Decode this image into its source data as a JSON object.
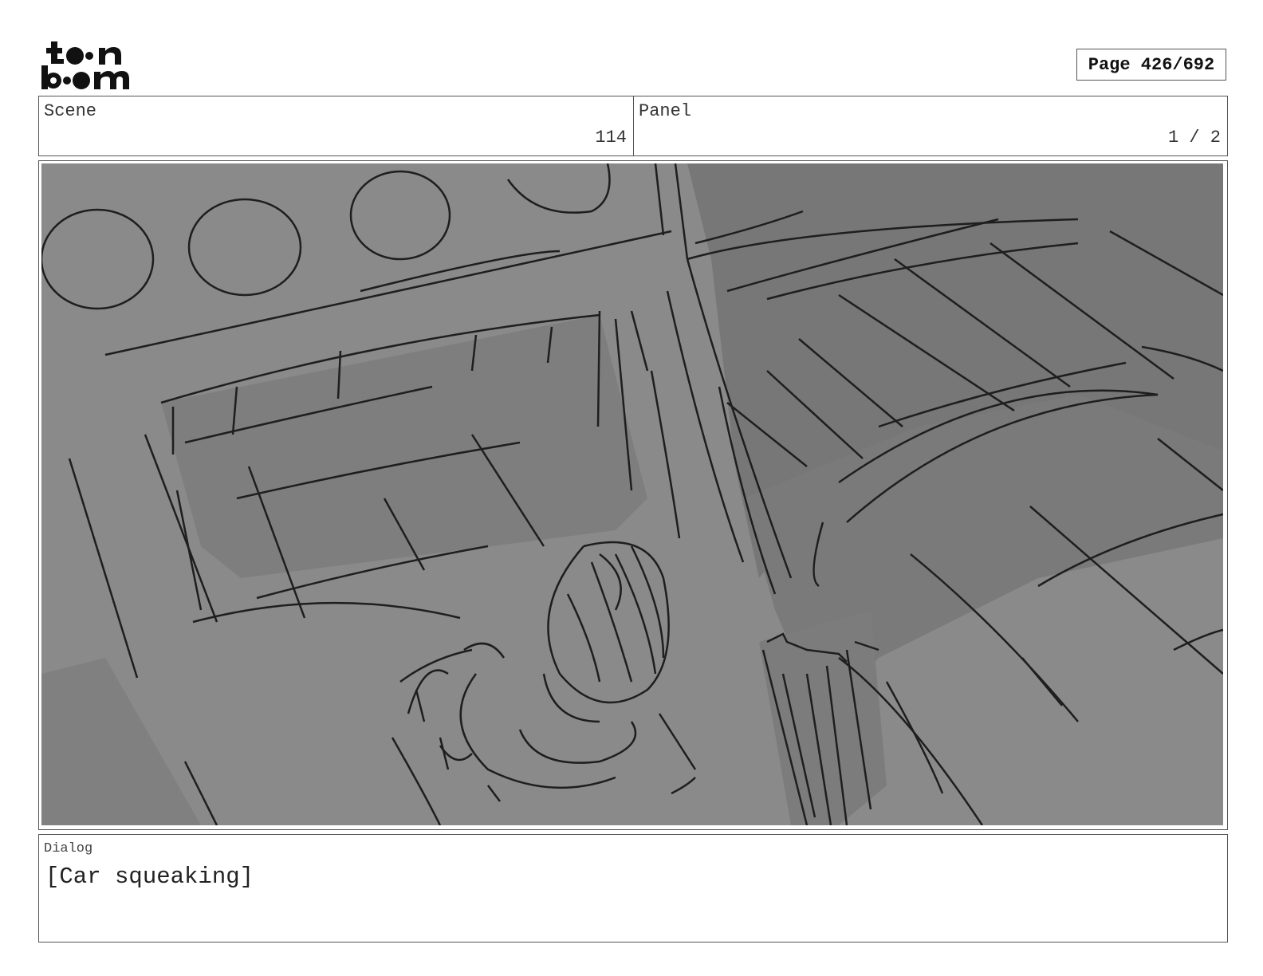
{
  "header": {
    "page_label": "Page 426/692",
    "logo_name": "toon-boom-logo"
  },
  "scene": {
    "label": "Scene",
    "value": "114"
  },
  "panel": {
    "label": "Panel",
    "value": "1 / 2"
  },
  "artwork": {
    "description_icon": "car-interior-sketch"
  },
  "dialog": {
    "label": "Dialog",
    "text": "[Car squeaking]"
  },
  "colors": {
    "border": "#555555",
    "sketch_bg": "#8a8a8a",
    "sketch_dark": "#767676"
  }
}
